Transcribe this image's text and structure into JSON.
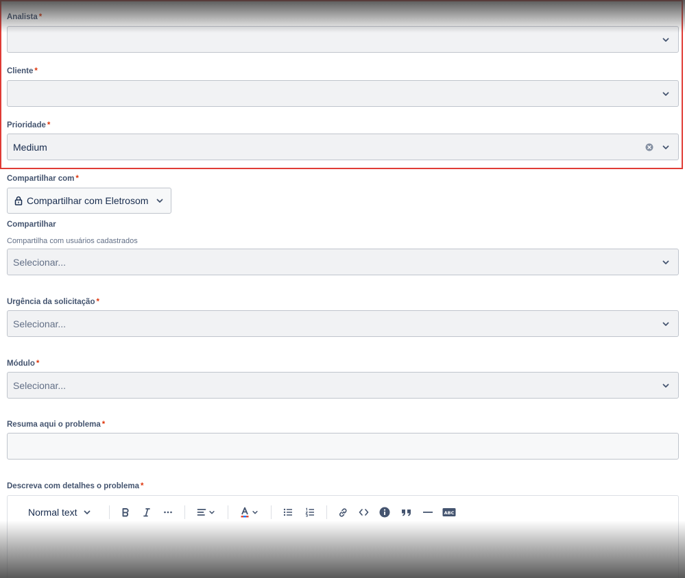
{
  "fields": {
    "analista": {
      "label": "Analista",
      "required_mark": "*",
      "value": ""
    },
    "cliente": {
      "label": "Cliente",
      "required_mark": "*",
      "value": ""
    },
    "prioridade": {
      "label": "Prioridade",
      "required_mark": "*",
      "value": "Medium"
    },
    "compartilhar_com": {
      "label": "Compartilhar com",
      "required_mark": "*",
      "button_label": "Compartilhar com Eletrosom"
    },
    "compartilhar": {
      "label": "Compartilhar",
      "help_text": "Compartilha com usuários cadastrados",
      "placeholder": "Selecionar..."
    },
    "urgencia": {
      "label": "Urgência da solicitação",
      "required_mark": "*",
      "placeholder": "Selecionar..."
    },
    "modulo": {
      "label": "Módulo",
      "required_mark": "*",
      "placeholder": "Selecionar..."
    },
    "resumo": {
      "label": "Resuma aqui o problema",
      "required_mark": "*",
      "value": ""
    },
    "descricao": {
      "label": "Descreva com detalhes o problema",
      "required_mark": "*",
      "toolbar": {
        "text_style": "Normal text",
        "icons": [
          "bold-icon",
          "italic-icon",
          "more-icon",
          "align-icon",
          "text-color-icon",
          "bullet-list-icon",
          "numbered-list-icon",
          "link-icon",
          "code-icon",
          "info-icon",
          "quote-icon",
          "divider-icon",
          "abc-icon"
        ]
      }
    }
  },
  "colors": {
    "required": "#de350b",
    "label": "#44546f",
    "field_bg": "#f1f2f4",
    "border": "#bfc4cc",
    "highlight": "#e03b35"
  }
}
